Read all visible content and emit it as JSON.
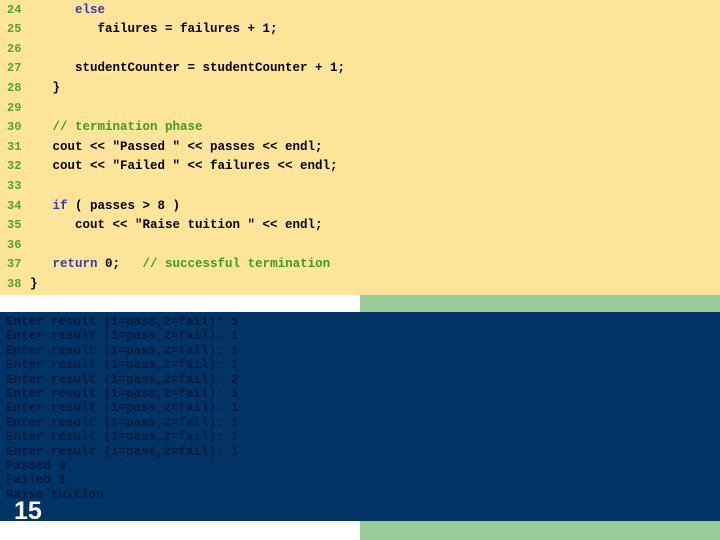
{
  "colors": {
    "code_background": "#FFE599",
    "console_background": "#003366",
    "accent_green": "#99CC99",
    "line_number": "#4FA62C",
    "keyword": "#3A3AA8",
    "comment": "#3A9A2A"
  },
  "code": {
    "lines": [
      {
        "num": "24",
        "segments": [
          {
            "text": "      ",
            "type": "plain"
          },
          {
            "text": "else",
            "type": "kw"
          }
        ]
      },
      {
        "num": "25",
        "segments": [
          {
            "text": "         failures = failures + 1;",
            "type": "plain"
          }
        ]
      },
      {
        "num": "26",
        "segments": []
      },
      {
        "num": "27",
        "segments": [
          {
            "text": "      studentCounter = studentCounter + 1;",
            "type": "plain"
          }
        ]
      },
      {
        "num": "28",
        "segments": [
          {
            "text": "   }",
            "type": "plain"
          }
        ]
      },
      {
        "num": "29",
        "segments": []
      },
      {
        "num": "30",
        "segments": [
          {
            "text": "   ",
            "type": "plain"
          },
          {
            "text": "// termination phase",
            "type": "cm"
          }
        ]
      },
      {
        "num": "31",
        "segments": [
          {
            "text": "   cout << \"Passed \" << passes << endl;",
            "type": "plain"
          }
        ]
      },
      {
        "num": "32",
        "segments": [
          {
            "text": "   cout << \"Failed \" << failures << endl;",
            "type": "plain"
          }
        ]
      },
      {
        "num": "33",
        "segments": []
      },
      {
        "num": "34",
        "segments": [
          {
            "text": "   ",
            "type": "plain"
          },
          {
            "text": "if",
            "type": "kw"
          },
          {
            "text": " ( passes > 8 )",
            "type": "plain"
          }
        ]
      },
      {
        "num": "35",
        "segments": [
          {
            "text": "      cout << \"Raise tuition \" << endl;",
            "type": "plain"
          }
        ]
      },
      {
        "num": "36",
        "segments": []
      },
      {
        "num": "37",
        "segments": [
          {
            "text": "   ",
            "type": "plain"
          },
          {
            "text": "return",
            "type": "kw"
          },
          {
            "text": " 0;   ",
            "type": "plain"
          },
          {
            "text": "// successful termination",
            "type": "cm"
          }
        ]
      },
      {
        "num": "38",
        "segments": [
          {
            "text": "}",
            "type": "plain"
          }
        ]
      }
    ]
  },
  "console": {
    "lines": [
      "Enter result (1=pass,2=fail): 1",
      "Enter result (1=pass,2=fail): 1",
      "Enter result (1=pass,2=fail): 1",
      "Enter result (1=pass,2=fail): 1",
      "Enter result (1=pass,2=fail): 2",
      "Enter result (1=pass,2=fail): 1",
      "Enter result (1=pass,2=fail): 1",
      "Enter result (1=pass,2=fail): 1",
      "Enter result (1=pass,2=fail): 1",
      "Enter result (1=pass,2=fail): 1",
      "Passed 9",
      "Failed 1",
      "Raise tuition"
    ]
  },
  "slide": {
    "number": "15"
  }
}
